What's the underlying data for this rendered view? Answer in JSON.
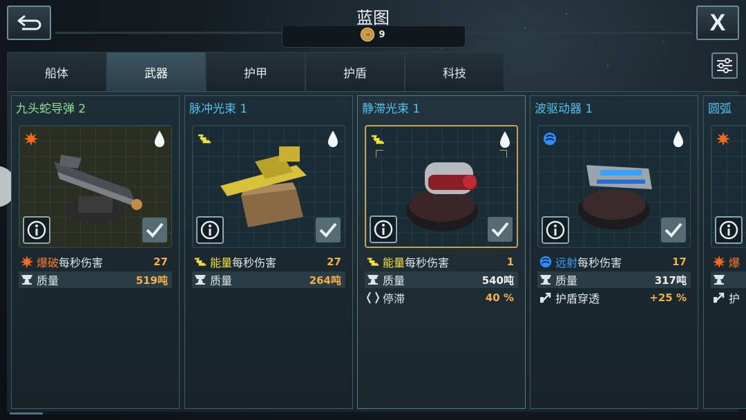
{
  "header": {
    "title": "蓝图",
    "currency_value": "9",
    "close_label": "X"
  },
  "tabs": [
    {
      "label": "船体",
      "active": false
    },
    {
      "label": "武器",
      "active": true
    },
    {
      "label": "护甲",
      "active": false
    },
    {
      "label": "护盾",
      "active": false
    },
    {
      "label": "科技",
      "active": false
    }
  ],
  "cards": [
    {
      "title": "九头蛇导弹 2",
      "title_color": "#8fe08a",
      "damage_type": "explosive",
      "dps_highlight": "爆破",
      "dps_suffix": "每秒伤害",
      "dps_value": "27",
      "mass_label": "质量",
      "mass_value": "519吨"
    },
    {
      "title": "脉冲光束 1",
      "title_color": "#52c2f2",
      "damage_type": "energy",
      "dps_highlight": "能量",
      "dps_suffix": "每秒伤害",
      "dps_value": "27",
      "mass_label": "质量",
      "mass_value": "264吨"
    },
    {
      "title": "静滞光束 1",
      "title_color": "#52c2f2",
      "damage_type": "energy",
      "selected": true,
      "dps_highlight": "能量",
      "dps_suffix": "每秒伤害",
      "dps_value": "1",
      "mass_label": "质量",
      "mass_value": "540吨",
      "extra_label": "停滞",
      "extra_value": "40 %"
    },
    {
      "title": "波驱动器 1",
      "title_color": "#52c2f2",
      "damage_type": "far-shot",
      "dps_highlight": "远射",
      "dps_suffix": "每秒伤害",
      "dps_value": "17",
      "mass_label": "质量",
      "mass_value": "317吨",
      "extra_label": "护盾穿透",
      "extra_value": "+25 %"
    },
    {
      "title": "圆弧",
      "title_color": "#52c2f2",
      "damage_type": "explosive",
      "dps_highlight": "爆",
      "dps_suffix": "",
      "dps_value": "",
      "mass_label": "",
      "mass_value": "",
      "extra_label": "护",
      "extra_value": ""
    }
  ],
  "colors": {
    "explosive": "#ff6a1a",
    "energy": "#f6e03a",
    "far_shot": "#2f8cff",
    "value": "#f5b04a",
    "selected_frame": "#c4a154"
  },
  "icons": {
    "back": "back-arrow-icon",
    "close": "close-icon",
    "filter": "sliders-icon",
    "currency": "skull-medal-icon",
    "info": "info-icon",
    "check": "checkmark-icon",
    "rarity": "droplet-icon",
    "mass": "anvil-icon",
    "stasis": "stasis-icon",
    "shield_pierce": "piercing-arrow-icon"
  }
}
